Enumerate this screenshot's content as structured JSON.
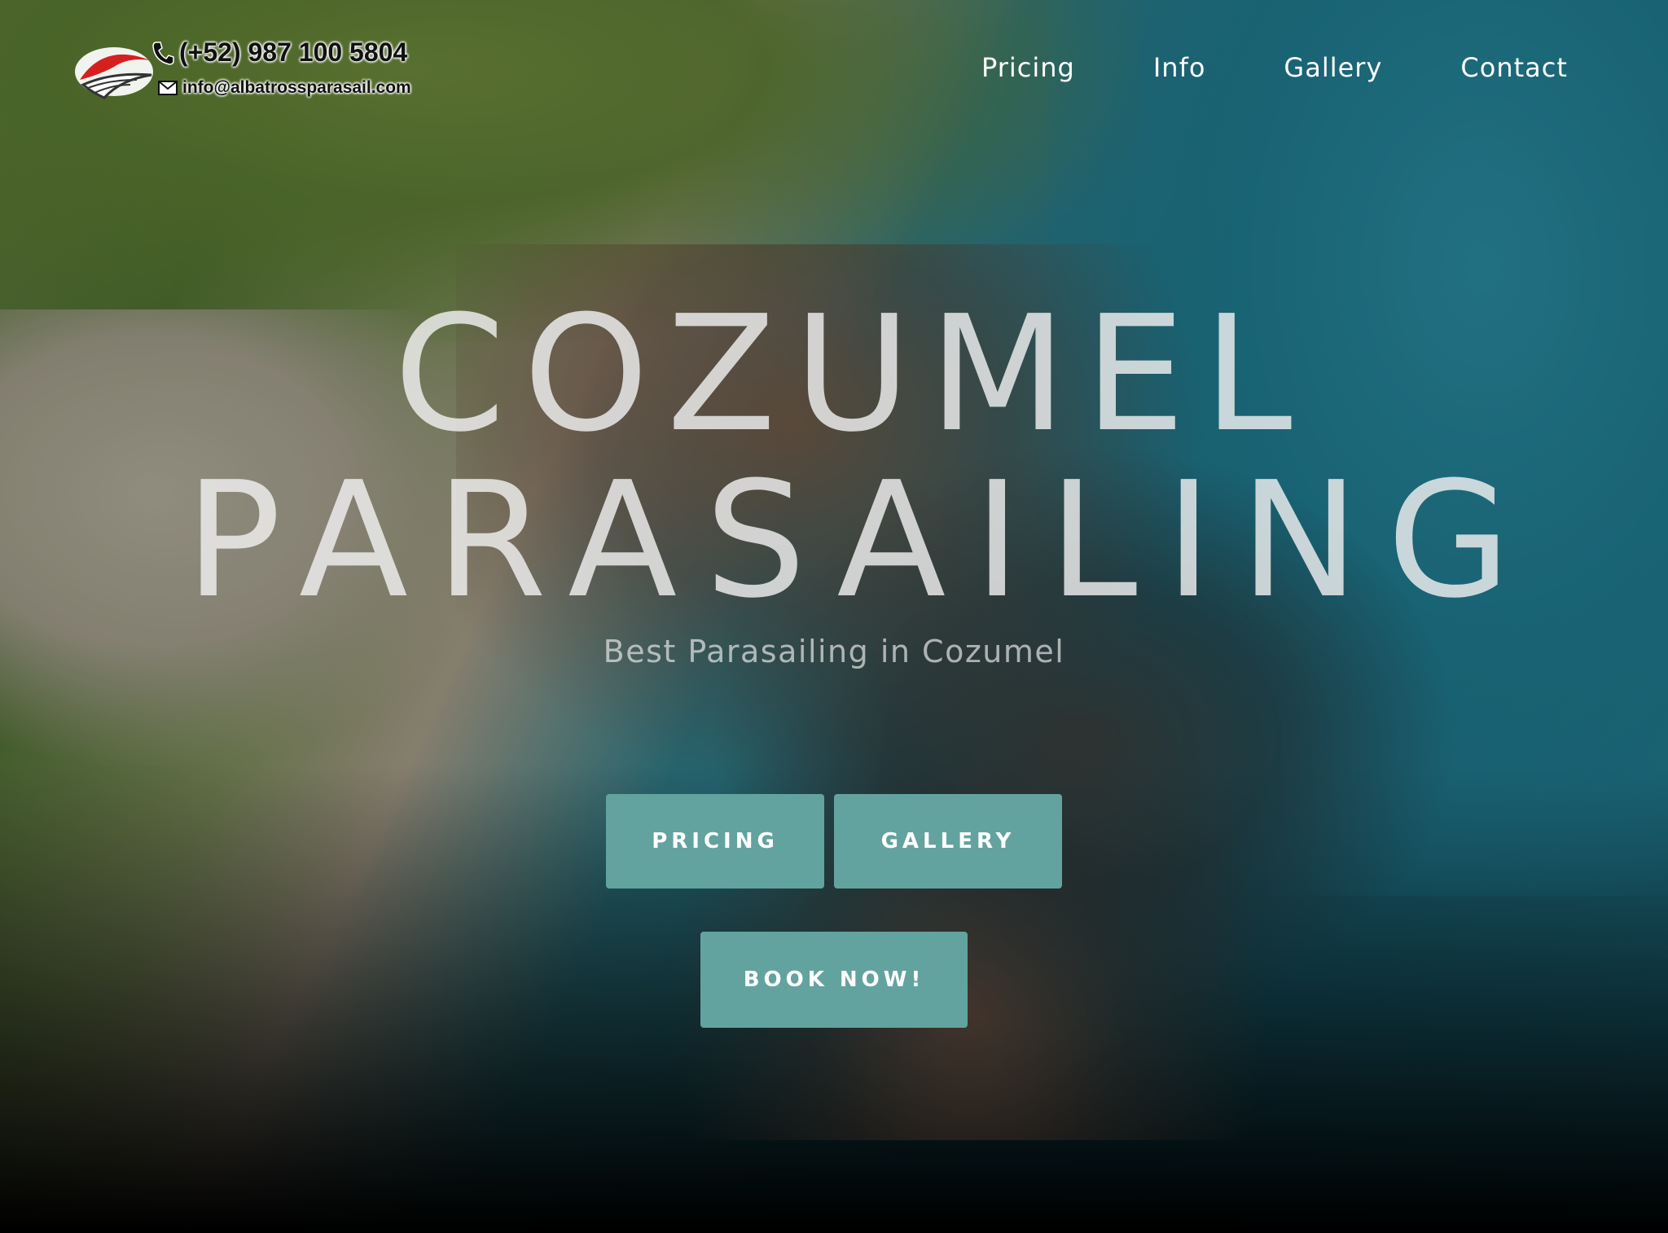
{
  "header": {
    "phone": "(+52) 987 100 5804",
    "email": "info@albatrossparasail.com",
    "logo_icon": "parasail-logo-icon",
    "phone_icon": "phone-icon",
    "email_icon": "mail-icon"
  },
  "nav": {
    "items": [
      {
        "label": "Pricing"
      },
      {
        "label": "Info"
      },
      {
        "label": "Gallery"
      },
      {
        "label": "Contact"
      }
    ]
  },
  "hero": {
    "title_line1": "COZUMEL",
    "title_line2": "PARASAILING",
    "subtitle": "Best Parasailing in Cozumel",
    "buttons": {
      "pricing": "PRICING",
      "gallery": "GALLERY",
      "book": "BOOK NOW!"
    }
  },
  "colors": {
    "button": "#63a39f",
    "title": "#f0f0f0",
    "nav_text": "#ffffff"
  }
}
